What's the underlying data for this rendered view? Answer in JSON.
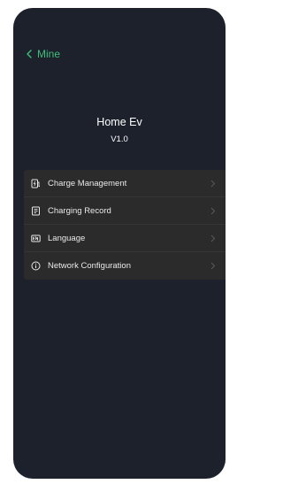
{
  "nav": {
    "back_label": "Mine"
  },
  "app": {
    "name": "Home Ev",
    "version": "V1.0"
  },
  "menu": {
    "items": [
      {
        "label": "Charge Management",
        "icon": "charge-management-icon"
      },
      {
        "label": "Charging Record",
        "icon": "charging-record-icon"
      },
      {
        "label": "Language",
        "icon": "language-icon"
      },
      {
        "label": "Network Configuration",
        "icon": "network-configuration-icon"
      }
    ]
  },
  "colors": {
    "background": "#1c212c",
    "accent": "#3fbf7a",
    "menu_background": "#2b2b2b",
    "text": "#ffffff"
  }
}
